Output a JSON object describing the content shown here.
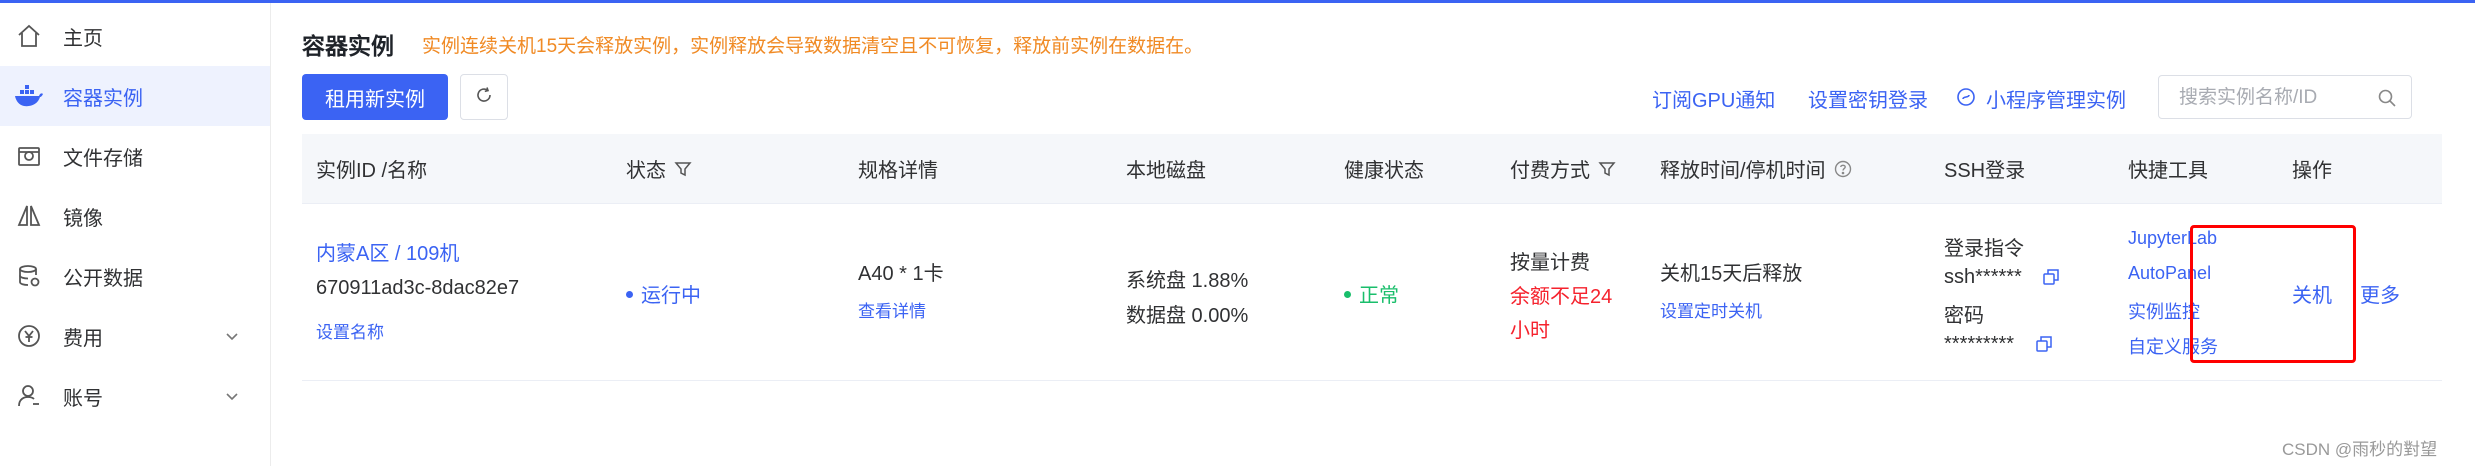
{
  "sidebar": {
    "items": [
      {
        "label": "主页",
        "icon": "home-icon"
      },
      {
        "label": "容器实例",
        "icon": "docker-whale-icon",
        "active": true
      },
      {
        "label": "文件存储",
        "icon": "storage-icon"
      },
      {
        "label": "镜像",
        "icon": "mirror-icon"
      },
      {
        "label": "公开数据",
        "icon": "database-icon"
      },
      {
        "label": "费用",
        "icon": "yen-icon",
        "expandable": true
      },
      {
        "label": "账号",
        "icon": "user-icon",
        "expandable": true
      }
    ]
  },
  "header": {
    "title": "容器实例",
    "notice": "实例连续关机15天会释放实例，实例释放会导致数据清空且不可恢复，释放前实例在数据在。"
  },
  "toolbar": {
    "rent_label": "租用新实例",
    "subscribe_gpu": "订阅GPU通知",
    "set_key_login": "设置密钥登录",
    "miniprogram": "小程序管理实例",
    "search_placeholder": "搜索实例名称/ID"
  },
  "table": {
    "headers": {
      "id_name": "实例ID /名称",
      "status": "状态",
      "spec": "规格详情",
      "disk": "本地磁盘",
      "health": "健康状态",
      "billing": "付费方式",
      "release": "释放时间/停机时间",
      "ssh": "SSH登录",
      "tools": "快捷工具",
      "actions": "操作"
    },
    "row": {
      "region": "内蒙A区 / 109机",
      "instance_id": "670911ad3c-8dac82e7",
      "set_name": "设置名称",
      "status": "运行中",
      "spec": "A40 * 1卡",
      "spec_detail": "查看详情",
      "system_disk": "系统盘 1.88%",
      "data_disk": "数据盘 0.00%",
      "health": "正常",
      "billing": "按量计费",
      "balance_line1": "余额不足24",
      "balance_line2": "小时",
      "release": "关机15天后释放",
      "set_timer": "设置定时关机",
      "ssh_cmd_label": "登录指令",
      "ssh_cmd": "ssh******",
      "password_label": "密码",
      "password": "*********",
      "tools": [
        "JupyterLab",
        "AutoPanel",
        "实例监控",
        "自定义服务"
      ],
      "shutdown": "关机",
      "more": "更多"
    }
  },
  "colors": {
    "accent": "#3b63f3",
    "notice": "#f08a24",
    "ok": "#19be6b",
    "warn": "#f5222d",
    "highlight_box": "#ff0000"
  },
  "watermark": "CSDN @雨秒的對望"
}
